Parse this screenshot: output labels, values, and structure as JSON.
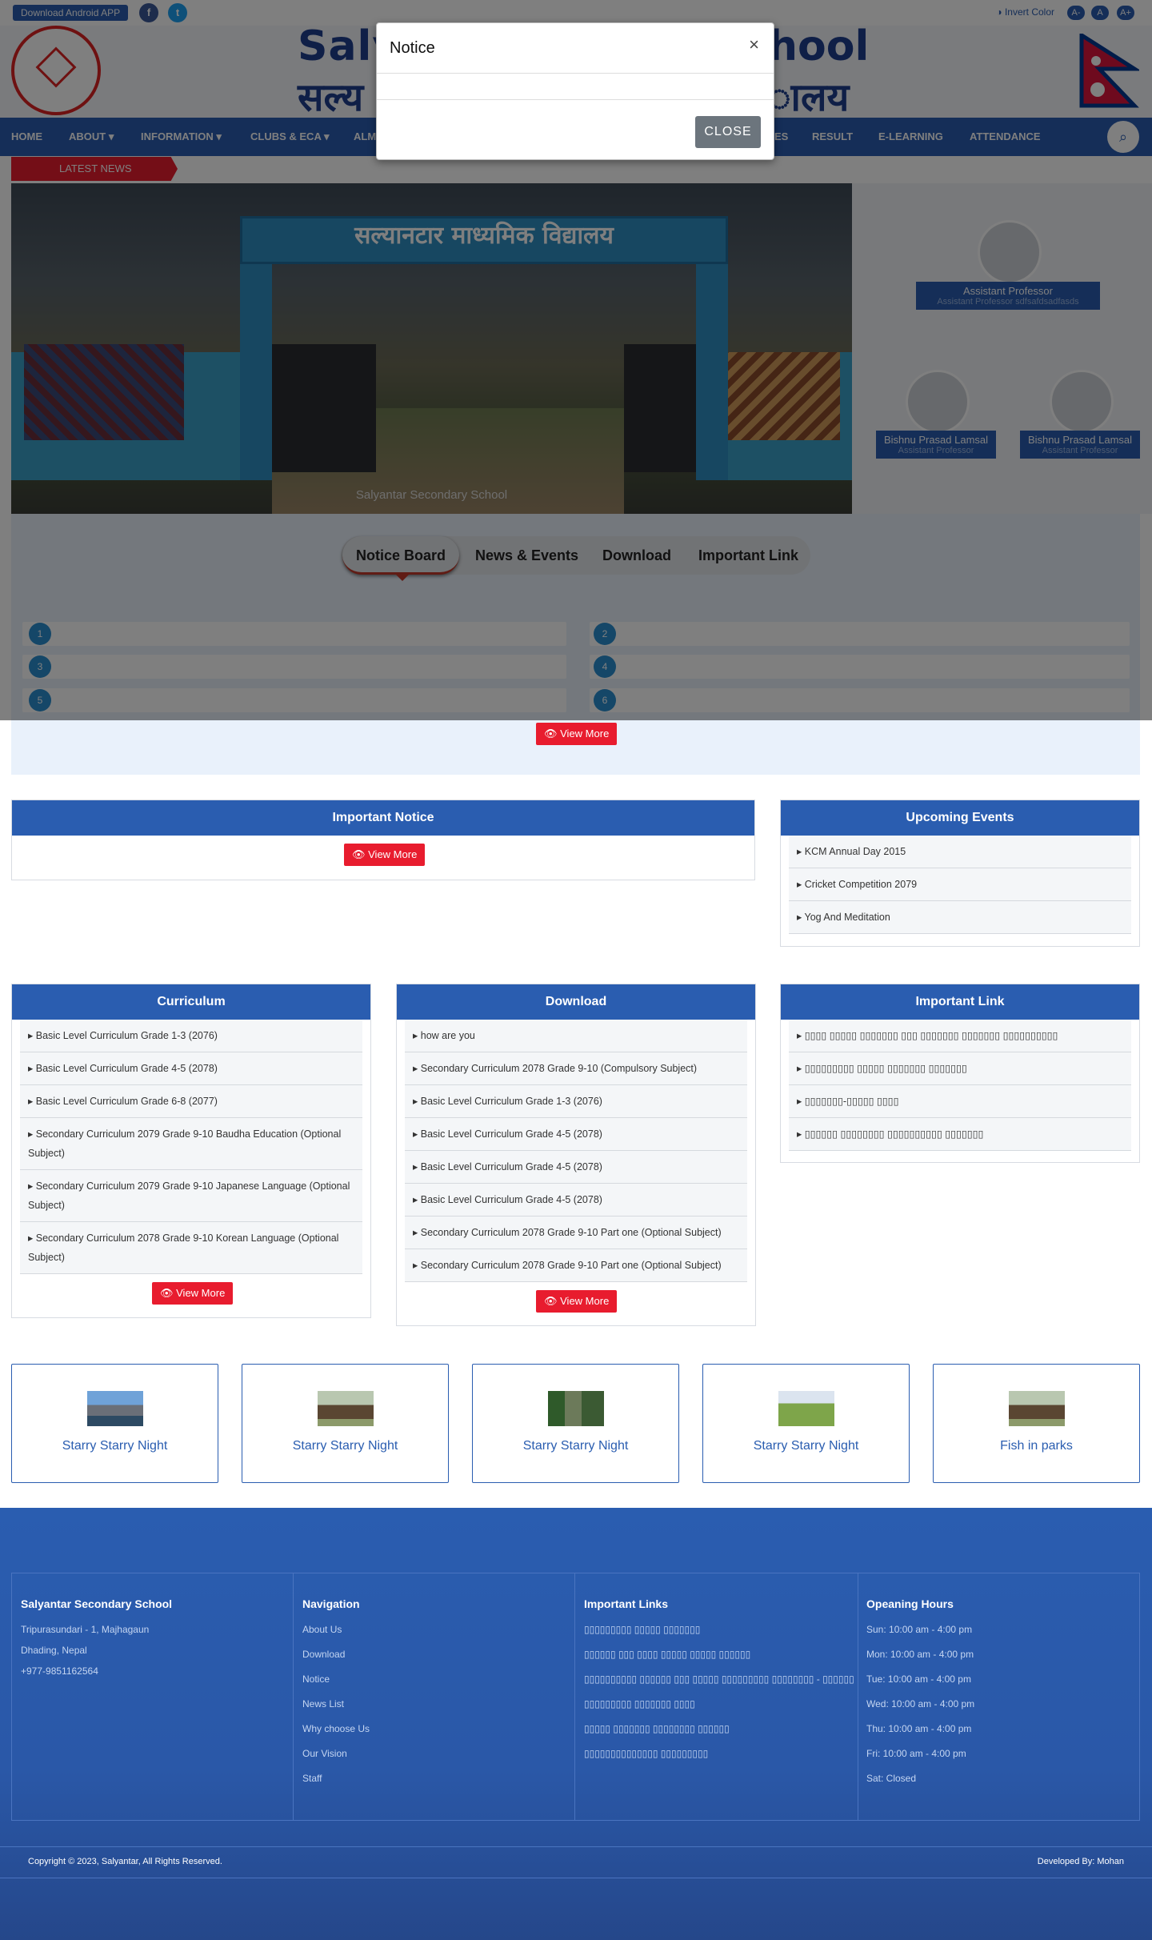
{
  "topbar": {
    "download_app": "Download Android APP",
    "facebook": "f",
    "twitter": "t",
    "invert": "Invert Color",
    "font_small": "A-",
    "font_normal": "A",
    "font_large": "A+"
  },
  "header": {
    "school_en_left": "Saly",
    "school_en_right": "hool",
    "school_ne_left": "सल्य",
    "school_ne_right": "ालय"
  },
  "nav": {
    "items": [
      "HOME",
      "ABOUT ▾",
      "INFORMATION ▾",
      "CLUBS & ECA ▾",
      "ALM",
      "ES",
      "RESULT",
      "E-LEARNING",
      "ATTENDANCE"
    ],
    "search": "⌕"
  },
  "latest_news": "LATEST NEWS",
  "slider": {
    "gate_text": "सल्यानटार माध्यमिक विद्यालय",
    "caption": "Salyantar Secondary School"
  },
  "staff": [
    {
      "name": "Assistant Professor",
      "role": "Assistant Professor sdfsafdsadfasds"
    },
    {
      "name": "Bishnu Prasad Lamsal",
      "role": "Assistant Professor"
    },
    {
      "name": "Bishnu Prasad Lamsal",
      "role": "Assistant Professor"
    }
  ],
  "tabs": [
    "Notice Board",
    "News & Events",
    "Download",
    "Important Link"
  ],
  "notice_numbers": [
    "1",
    "2",
    "3",
    "4",
    "5",
    "6"
  ],
  "view_more": "View More",
  "important_notice": {
    "title": "Important Notice"
  },
  "upcoming_events": {
    "title": "Upcoming Events",
    "items": [
      "KCM Annual Day 2015",
      "Cricket Competition 2079",
      "Yog And Meditation"
    ]
  },
  "curriculum": {
    "title": "Curriculum",
    "items": [
      "Basic Level Curriculum Grade 1-3 (2076)",
      "Basic Level Curriculum Grade 4-5 (2078)",
      "Basic Level Curriculum Grade 6-8 (2077)",
      "Secondary Curriculum 2079 Grade 9-10 Baudha Education (Optional Subject)",
      "Secondary Curriculum 2079 Grade 9-10 Japanese Language (Optional Subject)",
      "Secondary Curriculum 2078 Grade 9-10 Korean Language (Optional Subject)"
    ]
  },
  "download": {
    "title": "Download",
    "items": [
      "how are you",
      "Secondary Curriculum 2078 Grade 9-10 (Compulsory Subject)",
      "Basic Level Curriculum Grade 1-3 (2076)",
      "Basic Level Curriculum Grade 4-5 (2078)",
      "Basic Level Curriculum Grade 4-5 (2078)",
      "Basic Level Curriculum Grade 4-5 (2078)",
      "Secondary Curriculum 2078 Grade 9-10 Part one (Optional Subject)",
      "Secondary Curriculum 2078 Grade 9-10 Part one (Optional Subject)"
    ]
  },
  "important_link": {
    "title": "Important Link",
    "items": [
      "▯▯▯▯ ▯▯▯▯▯ ▯▯▯▯▯▯▯ ▯▯▯ ▯▯▯▯▯▯▯ ▯▯▯▯▯▯▯ ▯▯▯▯▯▯▯▯▯▯",
      "▯▯▯▯▯▯▯▯▯ ▯▯▯▯▯ ▯▯▯▯▯▯▯ ▯▯▯▯▯▯▯",
      "▯▯▯▯▯▯▯-▯▯▯▯▯ ▯▯▯▯",
      "▯▯▯▯▯▯ ▯▯▯▯▯▯▯▯ ▯▯▯▯▯▯▯▯▯▯ ▯▯▯▯▯▯▯"
    ]
  },
  "gallery": [
    "Starry Starry Night",
    "Starry Starry Night",
    "Starry Starry Night",
    "Starry Starry Night",
    "Fish in parks"
  ],
  "footer": {
    "school": {
      "title": "Salyantar Secondary School",
      "lines": [
        " Tripurasundari - 1, Majhagaun",
        "Dhading, Nepal",
        "+977-9851162564"
      ]
    },
    "navigation": {
      "title": "Navigation",
      "links": [
        "About Us",
        "Download",
        "Notice",
        "News List",
        "Why choose Us",
        "Our Vision",
        "Staff"
      ]
    },
    "important_links": {
      "title": "Important Links",
      "links": [
        "▯▯▯▯▯▯▯▯▯ ▯▯▯▯▯ ▯▯▯▯▯▯▯",
        "▯▯▯▯▯▯ ▯▯▯ ▯▯▯▯ ▯▯▯▯▯ ▯▯▯▯▯ ▯▯▯▯▯▯",
        "▯▯▯▯▯▯▯▯▯▯ ▯▯▯▯▯▯ ▯▯▯ ▯▯▯▯▯ ▯▯▯▯▯▯▯▯▯ ▯▯▯▯▯▯▯▯ - ▯▯▯▯▯▯",
        "▯▯▯▯▯▯▯▯▯ ▯▯▯▯▯▯▯ ▯▯▯▯",
        "▯▯▯▯▯ ▯▯▯▯▯▯▯ ▯▯▯▯▯▯▯▯ ▯▯▯▯▯▯",
        "▯▯▯▯▯▯▯▯▯▯▯▯▯▯ ▯▯▯▯▯▯▯▯▯"
      ]
    },
    "hours": {
      "title": "Opeaning Hours",
      "lines": [
        "Sun: 10:00 am - 4:00 pm",
        "Mon: 10:00 am - 4:00 pm",
        "Tue: 10:00 am - 4:00 pm",
        "Wed: 10:00 am - 4:00 pm",
        "Thu: 10:00 am - 4:00 pm",
        "Fri: 10:00 am - 4:00 pm",
        "Sat: Closed"
      ]
    },
    "copyright": "Copyright © 2023, Salyantar, All Rights Reserved.",
    "developer": "Developed By: Mohan"
  },
  "modal": {
    "title": "Notice",
    "close_x": "×",
    "close_button": "CLOSE"
  }
}
